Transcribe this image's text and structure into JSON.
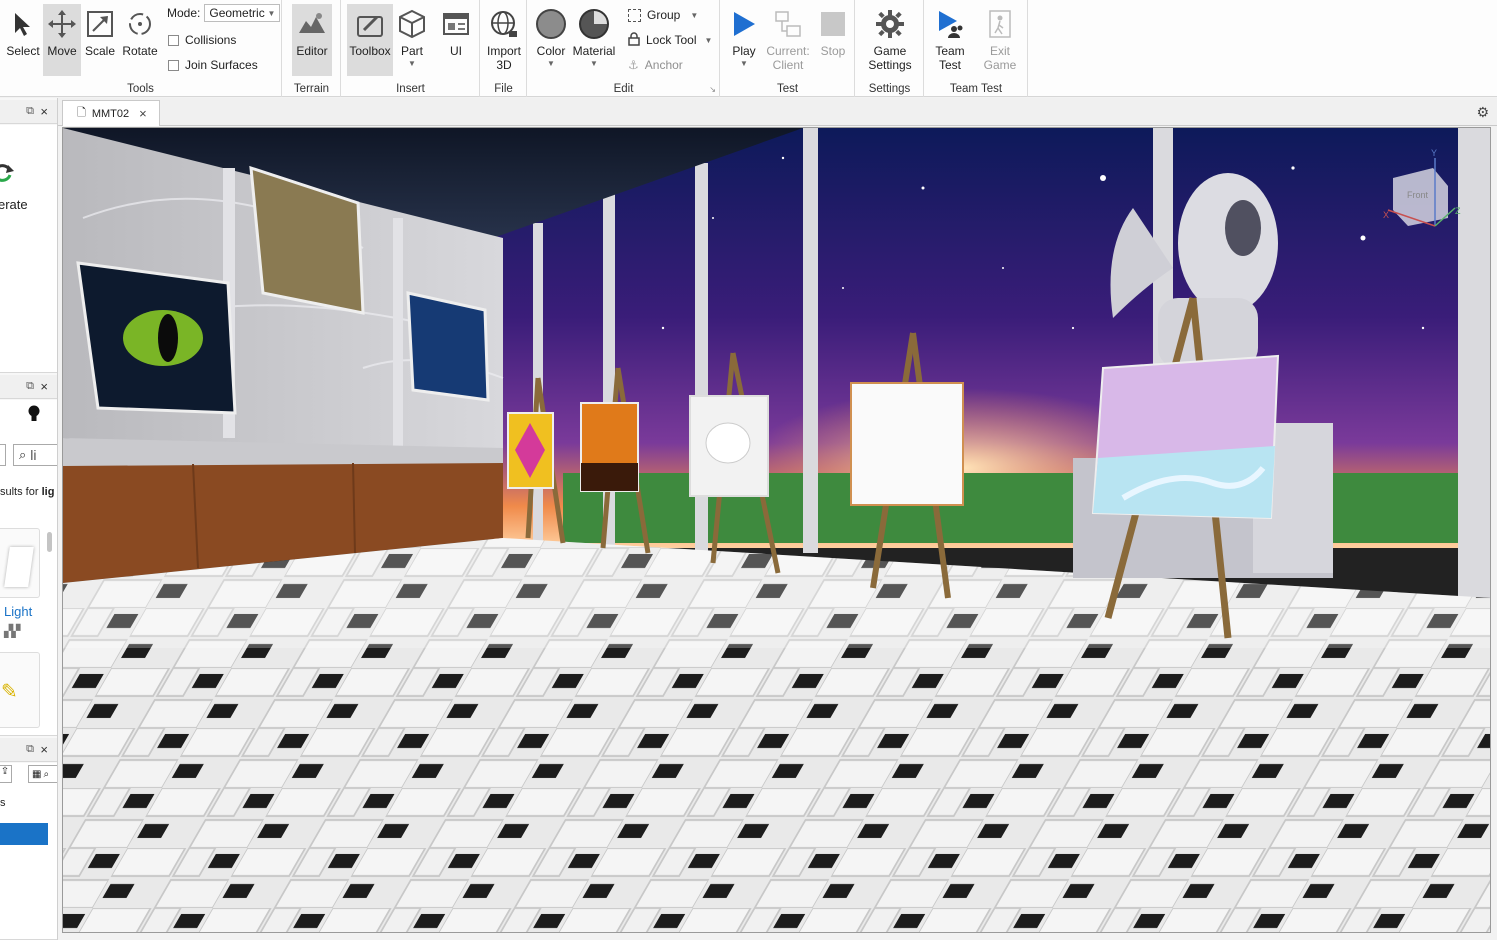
{
  "ribbon": {
    "tools": {
      "label": "Tools",
      "select": "Select",
      "move": "Move",
      "scale": "Scale",
      "rotate": "Rotate",
      "mode_label": "Mode:",
      "mode_value": "Geometric",
      "collisions": "Collisions",
      "join_surfaces": "Join Surfaces"
    },
    "terrain": {
      "label": "Terrain",
      "editor": "Editor"
    },
    "insert": {
      "label": "Insert",
      "toolbox": "Toolbox",
      "part": "Part",
      "ui": "UI"
    },
    "file": {
      "label": "File",
      "import_line1": "Import",
      "import_line2": "3D"
    },
    "edit": {
      "label": "Edit",
      "color": "Color",
      "material": "Material",
      "group": "Group",
      "lock_tool": "Lock Tool",
      "anchor": "Anchor"
    },
    "test": {
      "label": "Test",
      "play": "Play",
      "current_line1": "Current:",
      "current_line2": "Client",
      "stop": "Stop"
    },
    "settings": {
      "label": "Settings",
      "game_line1": "Game",
      "game_line2": "Settings"
    },
    "team_test": {
      "label": "Team Test",
      "team_line1": "Team",
      "team_line2": "Test",
      "exit_line1": "Exit",
      "exit_line2": "Game"
    }
  },
  "left_panels": {
    "panel1_text": "erate",
    "search_placeholder": "li",
    "results_prefix": "sults for ",
    "results_term": "lig",
    "item_label": "Light",
    "panel3_text": "s"
  },
  "tabs": [
    {
      "label": "MMT02"
    }
  ],
  "viewcube": {
    "face": "Front",
    "x_axis": "X",
    "y_axis": "Y",
    "z_axis": "Z"
  },
  "colors": {
    "accent_blue": "#1a73c7",
    "play_blue": "#1f6fd1",
    "ribbon_bg": "#fdfdfd",
    "sky_purple": "#3a1d79"
  }
}
